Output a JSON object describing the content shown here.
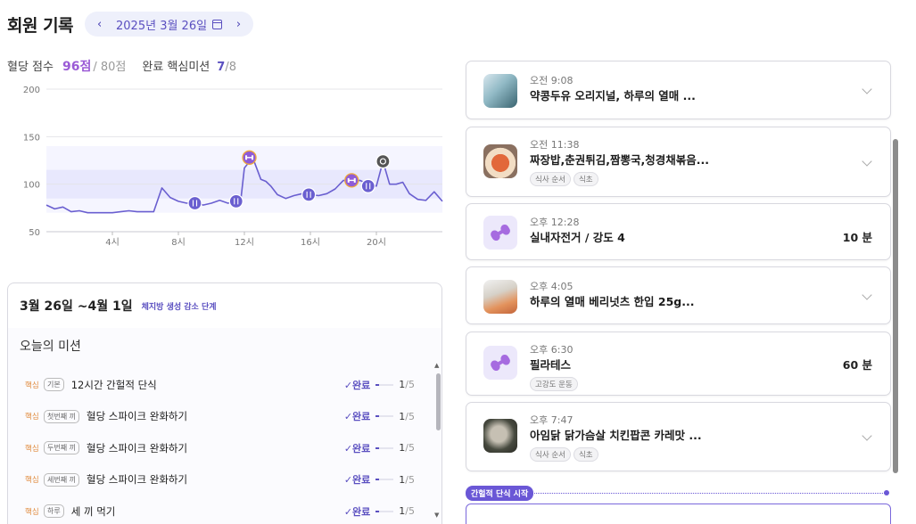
{
  "header": {
    "title": "회원 기록",
    "date": "2025년 3월 26일",
    "prev_label": "‹",
    "next_label": "›"
  },
  "score": {
    "label": "혈당 점수",
    "value": "96점",
    "total": "/ 80점",
    "mission_label": "완료 핵심미션",
    "mission_done": "7",
    "mission_total": "/8"
  },
  "chart_data": {
    "type": "line",
    "title": "",
    "xlabel": "",
    "ylabel": "",
    "ylim": [
      50,
      200
    ],
    "xlim": [
      0,
      24
    ],
    "yticks": [
      "200",
      "150",
      "100",
      "50"
    ],
    "xticks": [
      {
        "x": 4,
        "label": "4시"
      },
      {
        "x": 8,
        "label": "8시"
      },
      {
        "x": 12,
        "label": "12시"
      },
      {
        "x": 16,
        "label": "16시"
      },
      {
        "x": 20,
        "label": "20시"
      }
    ],
    "target_band": [
      70,
      140
    ],
    "highlight_band": [
      85,
      115
    ],
    "series": [
      {
        "color": "#6a5fd0",
        "x": [
          0,
          0.5,
          1,
          1.5,
          2,
          2.5,
          3,
          3.5,
          4,
          4.5,
          5,
          5.5,
          6,
          6.5,
          7,
          7.5,
          8,
          8.5,
          9,
          9.5,
          10,
          10.5,
          11,
          11.5,
          11.8,
          12,
          12.5,
          13,
          13.3,
          13.6,
          14,
          14.5,
          15,
          15.5,
          16,
          16.5,
          17,
          17.5,
          18,
          18.5,
          19,
          19.5,
          20,
          20.4,
          20.8,
          21.2,
          21.6,
          22,
          22.5,
          23,
          23.5,
          24
        ],
        "y": [
          78,
          74,
          76,
          71,
          72,
          70,
          70,
          70,
          70,
          71,
          72,
          71,
          71,
          71,
          96,
          86,
          82,
          80,
          81,
          78,
          80,
          83,
          80,
          82,
          86,
          117,
          128,
          105,
          103,
          98,
          89,
          85,
          88,
          90,
          89,
          88,
          90,
          95,
          104,
          103,
          104,
          100,
          98,
          124,
          100,
          100,
          102,
          90,
          84,
          83,
          92,
          82
        ]
      }
    ],
    "markers": [
      {
        "x": 9,
        "y": 80,
        "icon": "meal-icon"
      },
      {
        "x": 11.5,
        "y": 82,
        "icon": "meal-icon"
      },
      {
        "x": 12.3,
        "y": 128,
        "icon": "exercise-icon"
      },
      {
        "x": 15.9,
        "y": 89,
        "icon": "meal-icon"
      },
      {
        "x": 18.5,
        "y": 104,
        "icon": "exercise-icon"
      },
      {
        "x": 19.5,
        "y": 98,
        "icon": "meal-icon"
      },
      {
        "x": 20.4,
        "y": 124,
        "icon": "fasting-icon"
      }
    ]
  },
  "panel": {
    "range": "3월 26일 ~4월 1일",
    "phase": "체지방 생성 감소 단계",
    "missions_title": "오늘의 미션",
    "missions": [
      {
        "core": "핵심",
        "tag": "기본",
        "title": "12시간 간헐적 단식",
        "status": "✓완료",
        "count": "1",
        "total": "/5",
        "progress": 0.2
      },
      {
        "core": "핵심",
        "tag": "첫번째 끼",
        "title": "혈당 스파이크 완화하기",
        "status": "✓완료",
        "count": "1",
        "total": "/5",
        "progress": 0.2
      },
      {
        "core": "핵심",
        "tag": "두번째 끼",
        "title": "혈당 스파이크 완화하기",
        "status": "✓완료",
        "count": "1",
        "total": "/5",
        "progress": 0.2
      },
      {
        "core": "핵심",
        "tag": "세번째 끼",
        "title": "혈당 스파이크 완화하기",
        "status": "✓완료",
        "count": "1",
        "total": "/5",
        "progress": 0.2
      },
      {
        "core": "핵심",
        "tag": "하루",
        "title": "세 끼 먹기",
        "status": "✓완료",
        "count": "1",
        "total": "/5",
        "progress": 0.2
      }
    ]
  },
  "records": [
    {
      "time": "오전 9:08",
      "title": "약콩두유 오리지널, 하루의 열매 ...",
      "tags": [],
      "kind": "food",
      "thumb": "food1"
    },
    {
      "time": "오전 11:38",
      "title": "짜장밥,춘권튀김,짬뽕국,청경채볶음...",
      "tags": [
        "식사 순서",
        "식초"
      ],
      "kind": "food",
      "thumb": "food2"
    },
    {
      "time": "오후 12:28",
      "title": "실내자전거 / 강도 4",
      "tags": [],
      "kind": "exercise",
      "duration": "10 분"
    },
    {
      "time": "오후 4:05",
      "title": "하루의 열매 베리넛츠 한입 25g...",
      "tags": [],
      "kind": "food",
      "thumb": "food3"
    },
    {
      "time": "오후 6:30",
      "title": "필라테스",
      "tags": [
        "고강도 운동"
      ],
      "kind": "exercise",
      "duration": "60 분"
    },
    {
      "time": "오후 7:47",
      "title": "아임닭 닭가슴살 치킨팝콘 카레맛 ...",
      "tags": [
        "식사 순서",
        "식초"
      ],
      "kind": "food",
      "thumb": "food4"
    }
  ],
  "fasting": {
    "label": "간헐적 단식 시작"
  }
}
